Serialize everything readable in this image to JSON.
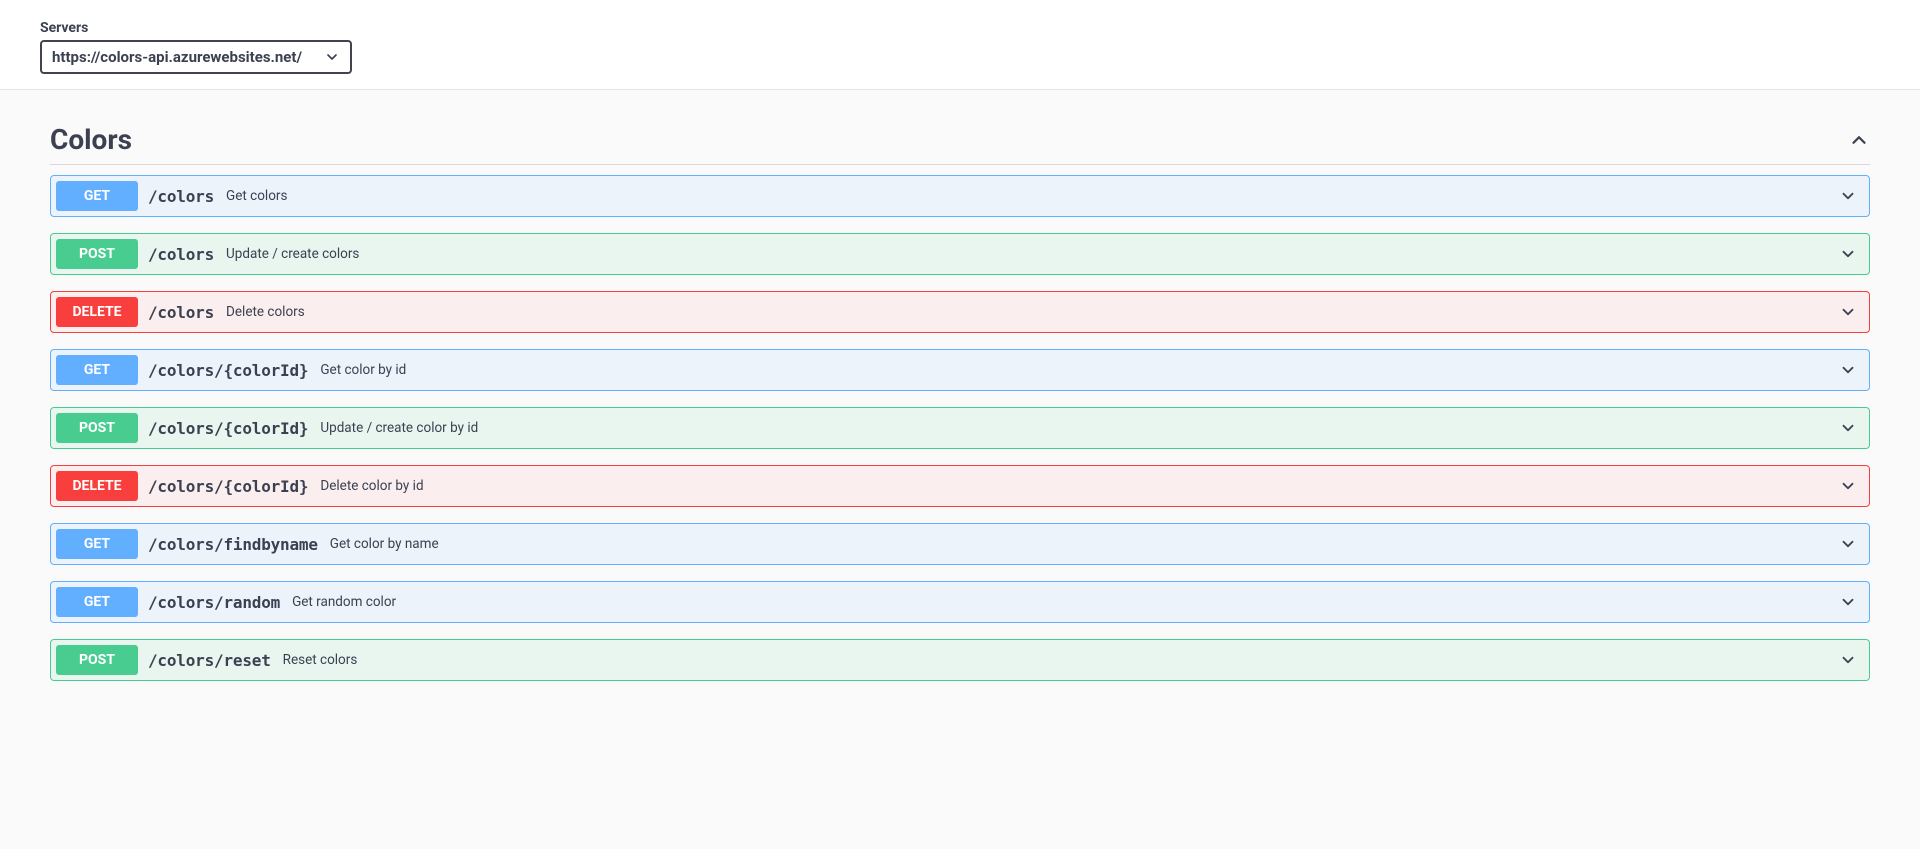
{
  "servers": {
    "label": "Servers",
    "selected": "https://colors-api.azurewebsites.net/"
  },
  "tag": {
    "name": "Colors"
  },
  "operations": [
    {
      "method": "GET",
      "path": "/colors",
      "summary": "Get colors"
    },
    {
      "method": "POST",
      "path": "/colors",
      "summary": "Update / create colors"
    },
    {
      "method": "DELETE",
      "path": "/colors",
      "summary": "Delete colors"
    },
    {
      "method": "GET",
      "path": "/colors/{colorId}",
      "summary": "Get color by id"
    },
    {
      "method": "POST",
      "path": "/colors/{colorId}",
      "summary": "Update / create color by id"
    },
    {
      "method": "DELETE",
      "path": "/colors/{colorId}",
      "summary": "Delete color by id"
    },
    {
      "method": "GET",
      "path": "/colors/findbyname",
      "summary": "Get color by name"
    },
    {
      "method": "GET",
      "path": "/colors/random",
      "summary": "Get random color"
    },
    {
      "method": "POST",
      "path": "/colors/reset",
      "summary": "Reset colors"
    }
  ]
}
